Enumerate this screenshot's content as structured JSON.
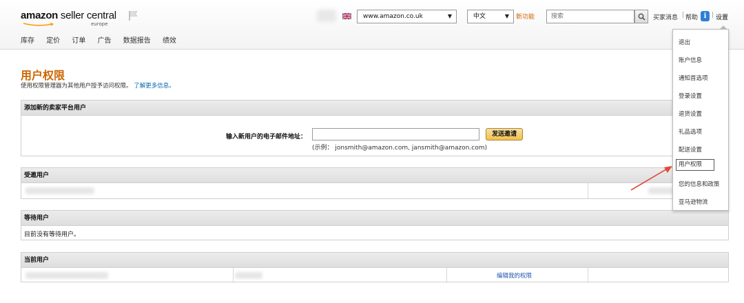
{
  "header": {
    "logo_main": "amazon",
    "logo_light": " seller central",
    "logo_region": "europe",
    "site_select": "www.amazon.co.uk",
    "lang_select": "中文",
    "new_feature": "新功能",
    "search_placeholder": "搜索",
    "link_messages": "买家消息",
    "link_help": "帮助",
    "info_glyph": "i",
    "link_settings": "设置",
    "separator": "|",
    "caret": "▼"
  },
  "nav": {
    "items": [
      "库存",
      "定价",
      "订单",
      "广告",
      "数据报告",
      "绩效"
    ]
  },
  "page": {
    "title": "用户权限",
    "description": "使用权限管理器为其他用户授予访问权限。",
    "learn_more": "了解更多信息。"
  },
  "add_user": {
    "heading": "添加新的卖家平台用户",
    "email_label": "输入新用户的电子邮件地址：",
    "invite_button": "发送邀请",
    "example": "(示例： jonsmith@amazon.com, jansmith@amazon.com)"
  },
  "invited": {
    "heading": "受邀用户"
  },
  "waiting": {
    "heading": "等待用户",
    "empty_text": "目前没有等待用户。"
  },
  "current": {
    "heading": "当前用户",
    "edit_link": "编辑我的权限"
  },
  "settings_menu": {
    "items": [
      "退出",
      "账户信息",
      "通知首选项",
      "登录设置",
      "退货设置",
      "礼品选项",
      "配送设置",
      "用户权限",
      "您的信息和政策",
      "亚马逊物流"
    ],
    "active": "用户权限"
  },
  "colors": {
    "title_orange": "#cc6600",
    "link_blue": "#0066aa",
    "annotation_red": "#e04a3a",
    "invite_button": "#f0c14b"
  }
}
